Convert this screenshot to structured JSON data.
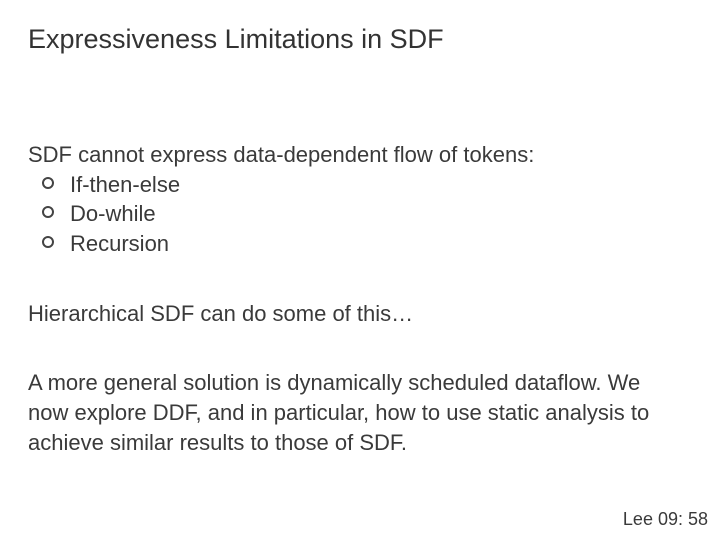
{
  "title": "Expressiveness Limitations in SDF",
  "intro": "SDF cannot express data-dependent flow of tokens:",
  "bullets": [
    "If-then-else",
    "Do-while",
    "Recursion"
  ],
  "para1": "Hierarchical SDF can do some of this…",
  "para2": "A more general solution is dynamically scheduled dataflow. We now explore DDF, and in particular, how to use static analysis to achieve similar results to those of SDF.",
  "footer": "Lee 09: 58"
}
